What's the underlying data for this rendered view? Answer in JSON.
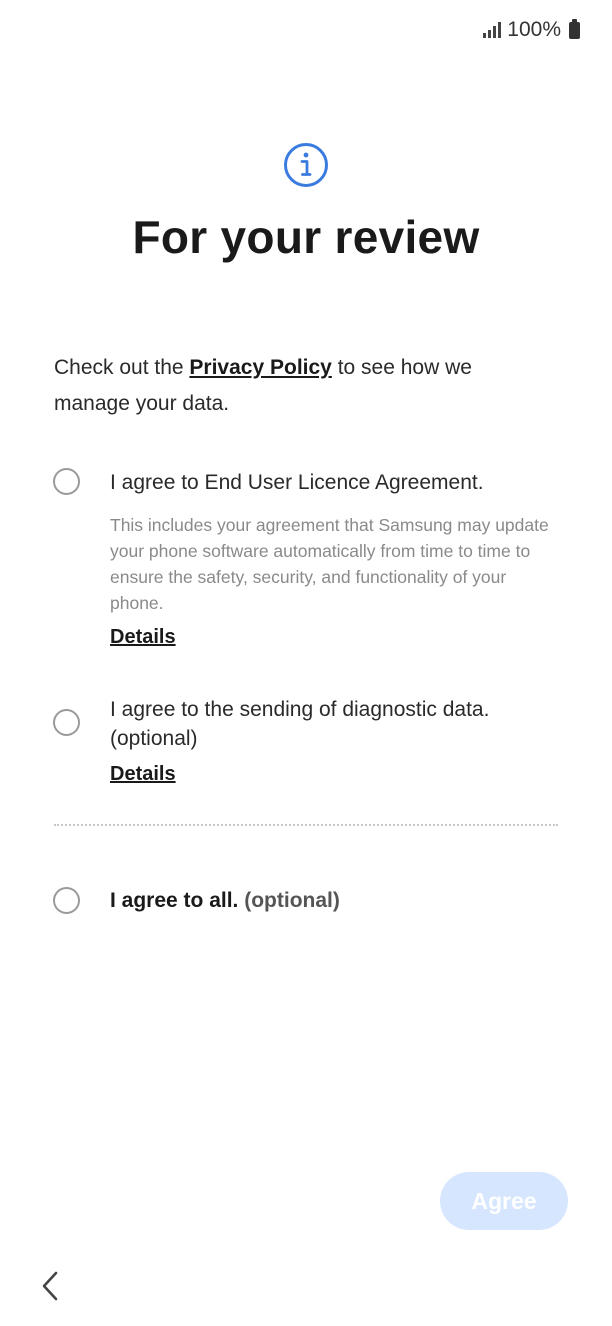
{
  "status_bar": {
    "battery": "100%"
  },
  "header": {
    "title": "For your review"
  },
  "intro": {
    "prefix": "Check out the ",
    "link": "Privacy Policy",
    "suffix": " to see how we manage your data."
  },
  "options": [
    {
      "label": "I agree to End User Licence Agreement.",
      "description": "This includes your agreement that Samsung may update your phone software automatically from time to time to ensure the safety, security, and functionality of your phone.",
      "details": "Details"
    },
    {
      "label": "I agree to the sending of diagnostic data. (optional)",
      "details": "Details"
    }
  ],
  "agree_all": {
    "label": "I agree to all.",
    "optional": " (optional)"
  },
  "footer": {
    "agree_button": "Agree"
  },
  "colors": {
    "accent": "#3a7be0",
    "button_disabled_bg": "#d6e6ff"
  },
  "icons": [
    "signal-icon",
    "battery-icon",
    "info-icon",
    "back-chevron-icon"
  ]
}
